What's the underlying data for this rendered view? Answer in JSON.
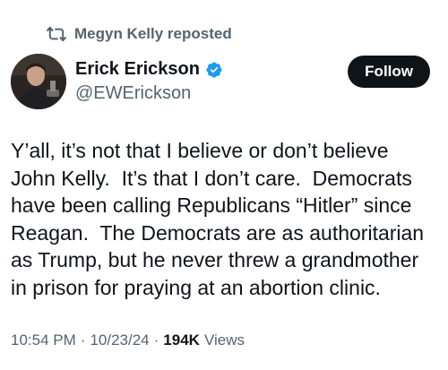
{
  "repost": {
    "label": "Megyn Kelly reposted",
    "icon": "repost-icon"
  },
  "author": {
    "display_name": "Erick Erickson",
    "handle": "@EWErickson",
    "verified": true,
    "verified_color": "#1d9bf0",
    "avatar_icon": "avatar"
  },
  "actions": {
    "follow_label": "Follow"
  },
  "tweet": {
    "text": "Y’all, it’s not that I believe or don’t believe John Kelly.  It’s that I don’t care.  Democrats have been calling Republicans “Hitler” since Reagan.  The Democrats are as authoritarian as Trump, but he never threw a grandmother in prison for praying at an abortion clinic."
  },
  "meta": {
    "time": "10:54 PM",
    "separator": "·",
    "date": "10/23/24",
    "views_count": "194K",
    "views_label": "Views"
  },
  "colors": {
    "text_primary": "#0f1419",
    "text_secondary": "#536471",
    "follow_bg": "#0f1419",
    "follow_text": "#ffffff"
  }
}
